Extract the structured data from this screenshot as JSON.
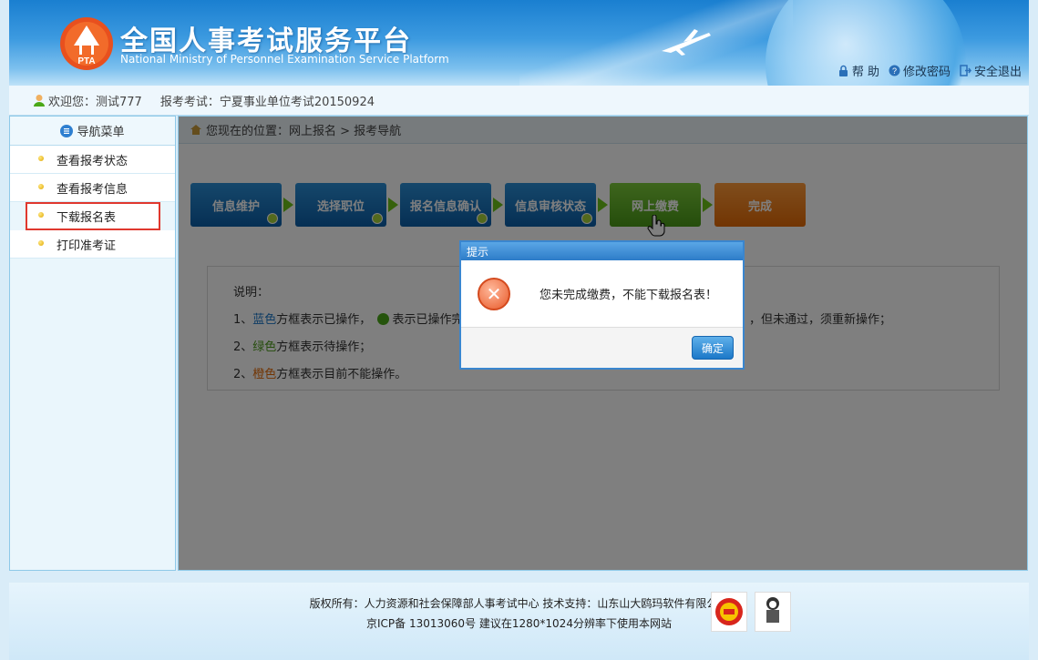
{
  "header": {
    "title_cn": "全国人事考试服务平台",
    "title_en": "National Ministry of Personnel Examination Service Platform",
    "logo_text": "PTA",
    "links": [
      {
        "label": "帮 助",
        "icon": "lock-icon"
      },
      {
        "label": "修改密码",
        "icon": "question-icon"
      },
      {
        "label": "安全退出",
        "icon": "exit-icon"
      }
    ]
  },
  "welcome": {
    "user_text": "欢迎您：测试777",
    "exam_text": "报考考试：宁夏事业单位考试20150924"
  },
  "sidebar": {
    "title": "导航菜单",
    "items": [
      {
        "label": "查看报考状态"
      },
      {
        "label": "查看报考信息"
      },
      {
        "label": "下载报名表"
      },
      {
        "label": "打印准考证"
      }
    ]
  },
  "breadcrumb": {
    "text": "您现在的位置：网上报名  >  报考导航"
  },
  "steps": [
    {
      "label": "信息维护",
      "color": "blue"
    },
    {
      "label": "选择职位",
      "color": "blue"
    },
    {
      "label": "报名信息确认",
      "color": "blue"
    },
    {
      "label": "信息审核状态",
      "color": "blue"
    },
    {
      "label": "网上缴费",
      "color": "green"
    },
    {
      "label": "完成",
      "color": "orange"
    }
  ],
  "description": {
    "title": "说明：",
    "line1_num": "1、",
    "line1_color": "蓝色",
    "line1_a": "方框表示已操作，",
    "line1_b": "表示已操作完成",
    "line1_tail": "，但未通过，须重新操作；",
    "line2_num": "2、",
    "line2_color": "绿色",
    "line2_rest": "方框表示待操作；",
    "line3_num": "2、",
    "line3_color": "橙色",
    "line3_rest": "方框表示目前不能操作。"
  },
  "dialog": {
    "title": "提示",
    "message": "您未完成缴费，不能下载报名表！",
    "ok_label": "确定"
  },
  "footer": {
    "line1": "版权所有：人力资源和社会保障部人事考试中心  技术支持：山东山大鸥玛软件有限公司",
    "line2": "京ICP备 13013060号  建议在1280*1024分辨率下使用本网站"
  }
}
